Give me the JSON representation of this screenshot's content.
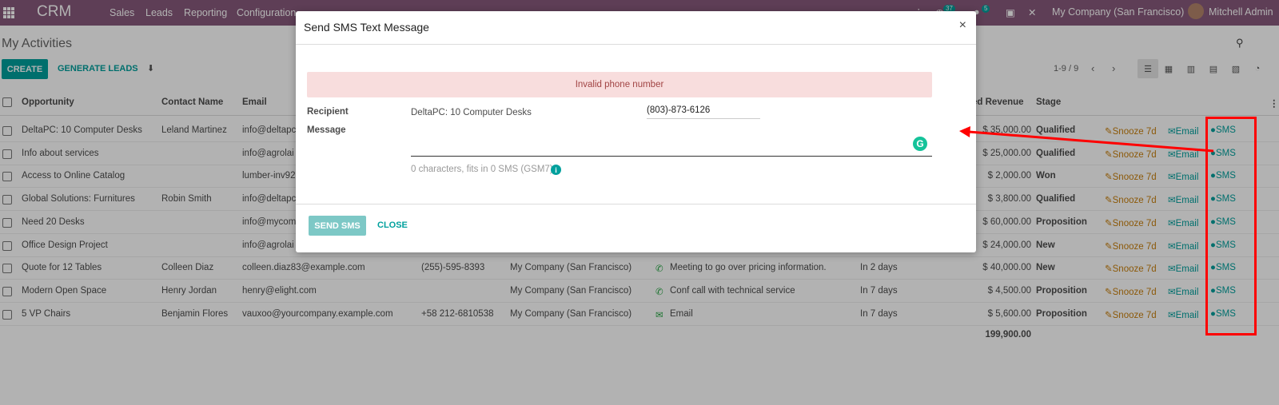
{
  "navbar": {
    "brand": "CRM",
    "menu": [
      "Sales",
      "Leads",
      "Reporting",
      "Configuration"
    ],
    "badges": [
      "37",
      "5"
    ],
    "company": "My Company (San Francisco)",
    "user": "Mitchell Admin"
  },
  "control_panel": {
    "breadcrumb": "My Activities",
    "create_label": "CREATE",
    "generate_label": "GENERATE LEADS",
    "pager": "1-9 / 9"
  },
  "table": {
    "headers": {
      "opportunity": "Opportunity",
      "contact": "Contact Name",
      "email": "Email",
      "revenue": "ed Revenue",
      "stage": "Stage"
    },
    "rows": [
      {
        "opportunity": "DeltaPC: 10 Computer Desks",
        "contact": "Leland Martinez",
        "email": "info@deltapc",
        "phone": "",
        "company": "",
        "activity": "",
        "date": "",
        "revenue": "$ 35,000.00",
        "stage": "Qualified"
      },
      {
        "opportunity": "Info about services",
        "contact": "",
        "email": "info@agrolai",
        "phone": "",
        "company": "",
        "activity": "",
        "date": "",
        "revenue": "$ 25,000.00",
        "stage": "Qualified"
      },
      {
        "opportunity": "Access to Online Catalog",
        "contact": "",
        "email": "lumber-inv92",
        "phone": "",
        "company": "",
        "activity": "",
        "date": "",
        "revenue": "$ 2,000.00",
        "stage": "Won"
      },
      {
        "opportunity": "Global Solutions: Furnitures",
        "contact": "Robin Smith",
        "email": "info@deltapc",
        "phone": "",
        "company": "",
        "activity": "",
        "date": "",
        "revenue": "$ 3,800.00",
        "stage": "Qualified"
      },
      {
        "opportunity": "Need 20 Desks",
        "contact": "",
        "email": "info@mycom",
        "phone": "",
        "company": "",
        "activity": "",
        "date": "",
        "revenue": "$ 60,000.00",
        "stage": "Proposition"
      },
      {
        "opportunity": "Office Design Project",
        "contact": "",
        "email": "info@agrolai",
        "phone": "",
        "company": "",
        "activity": "",
        "date": "",
        "revenue": "$ 24,000.00",
        "stage": "New"
      },
      {
        "opportunity": "Quote for 12 Tables",
        "contact": "Colleen Diaz",
        "email": "colleen.diaz83@example.com",
        "phone": "(255)-595-8393",
        "company": "My Company (San Francisco)",
        "activity": "Meeting to go over pricing information.",
        "date": "In 2 days",
        "revenue": "$ 40,000.00",
        "stage": "New"
      },
      {
        "opportunity": "Modern Open Space",
        "contact": "Henry Jordan",
        "email": "henry@elight.com",
        "phone": "",
        "company": "My Company (San Francisco)",
        "activity": "Conf call with technical service",
        "date": "In 7 days",
        "revenue": "$ 4,500.00",
        "stage": "Proposition"
      },
      {
        "opportunity": "5 VP Chairs",
        "contact": "Benjamin Flores",
        "email": "vauxoo@yourcompany.example.com",
        "phone": "+58 212-6810538",
        "company": "My Company (San Francisco)",
        "activity": "Email",
        "date": "In 7 days",
        "revenue": "$ 5,600.00",
        "stage": "Proposition"
      }
    ],
    "actions": {
      "snooze": "Snooze 7d",
      "email": "Email",
      "sms": "SMS"
    },
    "total": "199,900.00"
  },
  "modal": {
    "title": "Send SMS Text Message",
    "alert": "Invalid phone number",
    "recipient_label": "Recipient",
    "recipient_value": "DeltaPC: 10 Computer Desks",
    "phone_value": "(803)-873-6126",
    "message_label": "Message",
    "char_count": "0 characters, fits in 0 SMS (GSM7)",
    "send_label": "SEND SMS",
    "close_label": "CLOSE"
  },
  "colors": {
    "navbar": "#875a7b",
    "accent": "#00a09d",
    "annotation": "#ff0000"
  }
}
